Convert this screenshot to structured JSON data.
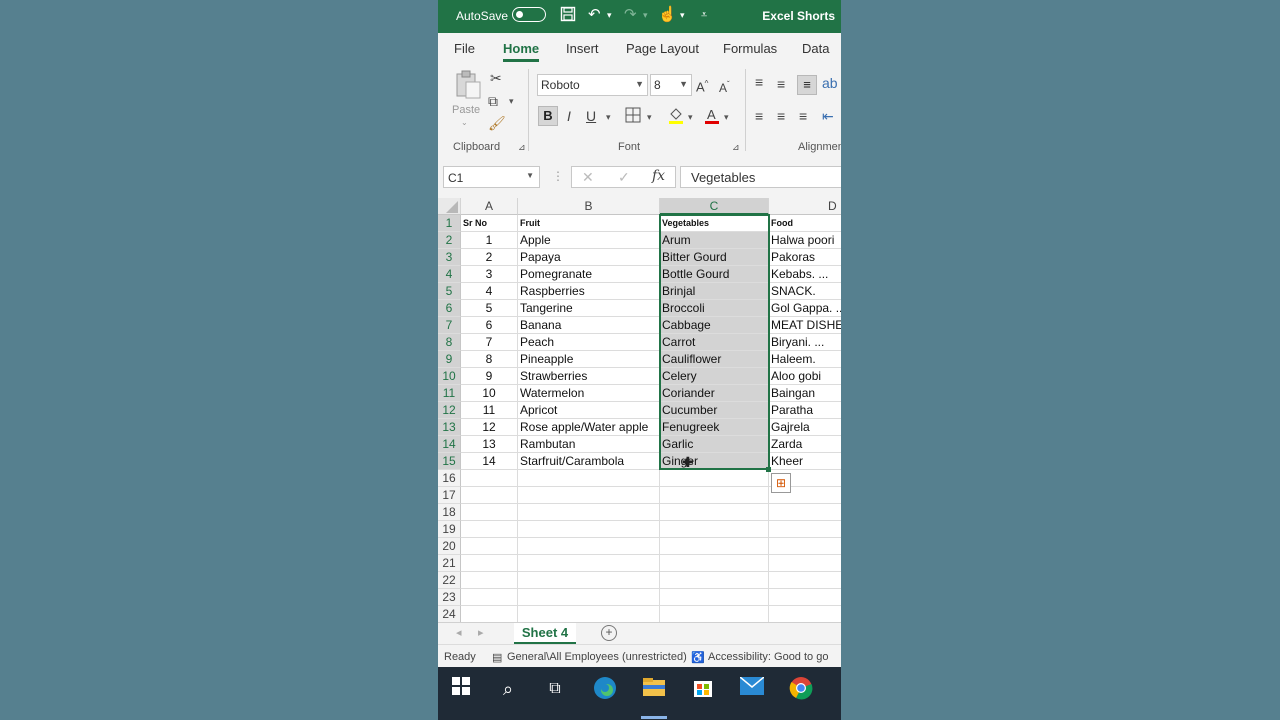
{
  "titlebar": {
    "autosave_label": "AutoSave",
    "document_name": "Excel Shorts"
  },
  "tabs": [
    {
      "label": "File",
      "active": false
    },
    {
      "label": "Home",
      "active": true
    },
    {
      "label": "Insert",
      "active": false
    },
    {
      "label": "Page Layout",
      "active": false
    },
    {
      "label": "Formulas",
      "active": false
    },
    {
      "label": "Data",
      "active": false
    }
  ],
  "ribbon": {
    "paste_label": "Paste",
    "font_name": "Roboto",
    "font_size": "8",
    "clipboard_group": "Clipboard",
    "font_group": "Font",
    "alignment_group": "Alignmen"
  },
  "formula_bar": {
    "name_box": "C1",
    "formula": "Vegetables"
  },
  "columns": [
    "A",
    "B",
    "C",
    "D"
  ],
  "rows": [
    {
      "n": "1",
      "a": "Sr No",
      "b": "Fruit",
      "c": "Vegetables",
      "d": "Food"
    },
    {
      "n": "2",
      "a": "1",
      "b": "Apple",
      "c": "Arum",
      "d": "Halwa poori"
    },
    {
      "n": "3",
      "a": "2",
      "b": "Papaya",
      "c": "Bitter Gourd",
      "d": "Pakoras"
    },
    {
      "n": "4",
      "a": "3",
      "b": "Pomegranate",
      "c": "Bottle Gourd",
      "d": "Kebabs. ..."
    },
    {
      "n": "5",
      "a": "4",
      "b": "Raspberries",
      "c": "Brinjal",
      "d": "SNACK."
    },
    {
      "n": "6",
      "a": "5",
      "b": "Tangerine",
      "c": "Broccoli",
      "d": "Gol Gappa. ..."
    },
    {
      "n": "7",
      "a": "6",
      "b": "Banana",
      "c": "Cabbage",
      "d": "MEAT DISHES"
    },
    {
      "n": "8",
      "a": "7",
      "b": "Peach",
      "c": "Carrot",
      "d": "Biryani. ..."
    },
    {
      "n": "9",
      "a": "8",
      "b": "Pineapple",
      "c": "Cauliflower",
      "d": "Haleem."
    },
    {
      "n": "10",
      "a": "9",
      "b": "Strawberries",
      "c": "Celery",
      "d": "Aloo gobi"
    },
    {
      "n": "11",
      "a": "10",
      "b": "Watermelon",
      "c": "Coriander",
      "d": "Baingan"
    },
    {
      "n": "12",
      "a": "11",
      "b": "Apricot",
      "c": "Cucumber",
      "d": "Paratha"
    },
    {
      "n": "13",
      "a": "12",
      "b": "Rose apple/Water apple",
      "c": "Fenugreek",
      "d": "Gajrela"
    },
    {
      "n": "14",
      "a": "13",
      "b": "Rambutan",
      "c": "Garlic",
      "d": "Zarda"
    },
    {
      "n": "15",
      "a": "14",
      "b": "Starfruit/Carambola",
      "c": "Ginger",
      "d": "Kheer"
    },
    {
      "n": "16",
      "a": "",
      "b": "",
      "c": "",
      "d": ""
    },
    {
      "n": "17",
      "a": "",
      "b": "",
      "c": "",
      "d": ""
    },
    {
      "n": "18",
      "a": "",
      "b": "",
      "c": "",
      "d": ""
    },
    {
      "n": "19",
      "a": "",
      "b": "",
      "c": "",
      "d": ""
    },
    {
      "n": "20",
      "a": "",
      "b": "",
      "c": "",
      "d": ""
    },
    {
      "n": "21",
      "a": "",
      "b": "",
      "c": "",
      "d": ""
    },
    {
      "n": "22",
      "a": "",
      "b": "",
      "c": "",
      "d": ""
    },
    {
      "n": "23",
      "a": "",
      "b": "",
      "c": "",
      "d": ""
    },
    {
      "n": "24",
      "a": "",
      "b": "",
      "c": "",
      "d": ""
    }
  ],
  "selection": {
    "column": "C",
    "from_row": 1,
    "to_row": 15
  },
  "sheet_tab": "Sheet 4",
  "status": {
    "ready": "Ready",
    "sensitivity": "General\\All Employees (unrestricted)",
    "accessibility": "Accessibility: Good to go"
  },
  "taskbar_icons": [
    "windows-icon",
    "search-icon",
    "task-view-icon",
    "edge-icon",
    "file-explorer-icon",
    "store-icon",
    "mail-icon",
    "chrome-icon"
  ],
  "colors": {
    "excel_green": "#217346",
    "background": "#56808f",
    "selection_fill": "#d3d3d3"
  }
}
